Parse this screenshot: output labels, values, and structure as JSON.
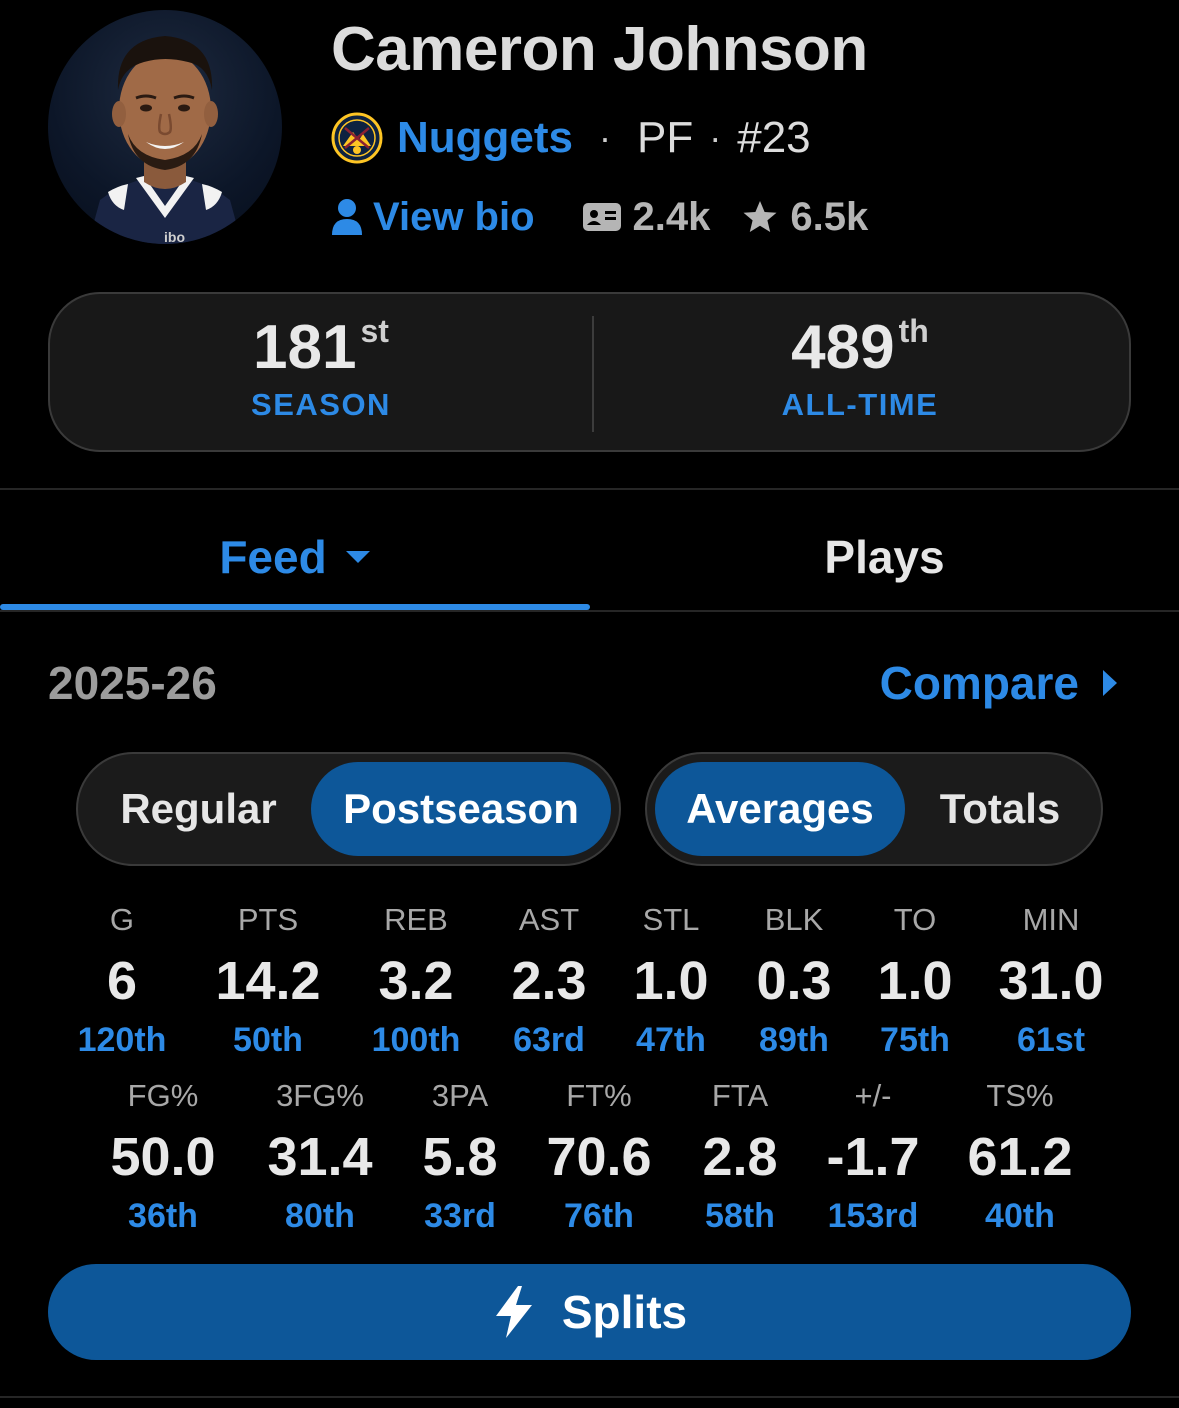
{
  "player": {
    "name": "Cameron Johnson",
    "team": "Nuggets",
    "position": "PF",
    "number": "#23",
    "bio_label": "View bio",
    "cards_count": "2.4k",
    "favorites_count": "6.5k",
    "jersey_text": "ibo"
  },
  "ranks": [
    {
      "value": "181",
      "suffix": "st",
      "label": "SEASON"
    },
    {
      "value": "489",
      "suffix": "th",
      "label": "ALL-TIME"
    }
  ],
  "tabs": {
    "feed": "Feed",
    "plays": "Plays"
  },
  "season": "2025-26",
  "compare": "Compare",
  "segment_type": {
    "regular": "Regular",
    "postseason": "Postseason",
    "selected": "Postseason"
  },
  "segment_mode": {
    "averages": "Averages",
    "totals": "Totals",
    "selected": "Averages"
  },
  "stats_row1": [
    {
      "h": "G",
      "v": "6",
      "r": "120th"
    },
    {
      "h": "PTS",
      "v": "14.2",
      "r": "50th"
    },
    {
      "h": "REB",
      "v": "3.2",
      "r": "100th"
    },
    {
      "h": "AST",
      "v": "2.3",
      "r": "63rd"
    },
    {
      "h": "STL",
      "v": "1.0",
      "r": "47th"
    },
    {
      "h": "BLK",
      "v": "0.3",
      "r": "89th"
    },
    {
      "h": "TO",
      "v": "1.0",
      "r": "75th"
    },
    {
      "h": "MIN",
      "v": "31.0",
      "r": "61st"
    }
  ],
  "stats_row2": [
    {
      "h": "FG%",
      "v": "50.0",
      "r": "36th"
    },
    {
      "h": "3FG%",
      "v": "31.4",
      "r": "80th"
    },
    {
      "h": "3PA",
      "v": "5.8",
      "r": "33rd"
    },
    {
      "h": "FT%",
      "v": "70.6",
      "r": "76th"
    },
    {
      "h": "FTA",
      "v": "2.8",
      "r": "58th"
    },
    {
      "h": "+/-",
      "v": "-1.7",
      "r": "153rd"
    },
    {
      "h": "TS%",
      "v": "61.2",
      "r": "40th"
    }
  ],
  "splits_label": "Splits",
  "colors": {
    "accent": "#2d8ae6",
    "selected_bg": "#0d5799",
    "background": "#000000",
    "card": "#181818"
  },
  "icons": {
    "team": "nuggets-logo-icon",
    "bio": "person-icon",
    "cards": "id-card-icon",
    "favorites": "star-icon",
    "feed_dropdown": "caret-down-icon",
    "compare": "caret-right-icon",
    "splits": "lightning-bolt-icon"
  }
}
